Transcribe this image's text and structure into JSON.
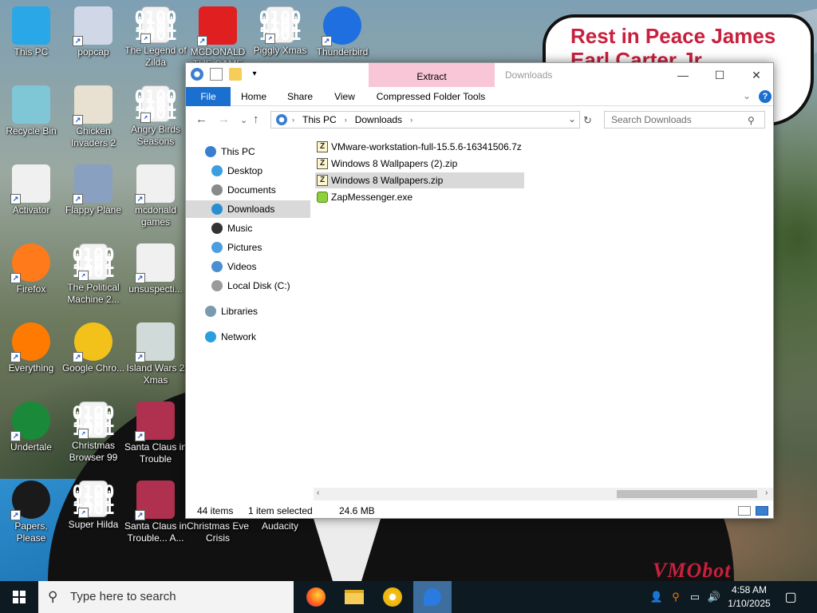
{
  "wallpaper": {
    "sign_text": "Rest in Peace James Earl Carter Jr.",
    "watermark": "VMObot"
  },
  "desktop_icons": [
    {
      "label": "This PC",
      "icon": "computer-icon",
      "color": "#2aa7e6"
    },
    {
      "label": "popcap",
      "icon": "popcap-icon",
      "color": "#d0d8e8"
    },
    {
      "label": "The Legend of Zilda",
      "icon": "binary-file-icon",
      "color": "#f3f3f3"
    },
    {
      "label": "MCDONALD THE GAME",
      "icon": "mcdonalds-icon",
      "color": "#e02020"
    },
    {
      "label": "Piggly Xmas",
      "icon": "binary-file-icon",
      "color": "#f3f3f3"
    },
    {
      "label": "Thunderbird",
      "icon": "thunderbird-icon",
      "color": "#1f6fe0"
    },
    {
      "label": "Recycle Bin",
      "icon": "recycle-bin-icon",
      "color": "#7fc7d7"
    },
    {
      "label": "Chicken Invaders 2",
      "icon": "chicken-invaders-icon",
      "color": "#e8e0d0"
    },
    {
      "label": "Angry Birds Seasons",
      "icon": "binary-file-icon",
      "color": "#f3f3f3"
    },
    {
      "label": "Activator",
      "icon": "blank-file-icon",
      "color": "#f0f0f0"
    },
    {
      "label": "Flappy Plane",
      "icon": "flappy-plane-icon",
      "color": "#8aa0c0"
    },
    {
      "label": "mcdonald games",
      "icon": "blank-file-icon",
      "color": "#f0f0f0"
    },
    {
      "label": "Firefox",
      "icon": "firefox-icon",
      "color": "#ff7a1a"
    },
    {
      "label": "The Political Machine 2...",
      "icon": "binary-file-icon",
      "color": "#f3f3f3"
    },
    {
      "label": "unsuspecti...",
      "icon": "blank-file-icon",
      "color": "#f0f0f0"
    },
    {
      "label": "Everything",
      "icon": "everything-search-icon",
      "color": "#ff7a00"
    },
    {
      "label": "Google Chro...",
      "icon": "chrome-icon",
      "color": "#f2c21a"
    },
    {
      "label": "Island Wars 2 Xmas",
      "icon": "island-wars-icon",
      "color": "#d0dad8"
    },
    {
      "label": "Undertale",
      "icon": "undertale-icon",
      "color": "#1a8a3a"
    },
    {
      "label": "Christmas Browser 99",
      "icon": "binary-file-icon",
      "color": "#f3f3f3"
    },
    {
      "label": "Santa Claus in Trouble",
      "icon": "santa-claus-icon",
      "color": "#b03050"
    },
    {
      "label": "Papers, Please",
      "icon": "papers-please-icon",
      "color": "#1a1a1a"
    },
    {
      "label": "Super Hilda",
      "icon": "binary-file-icon",
      "color": "#f3f3f3"
    },
    {
      "label": "Santa Claus in Trouble... A...",
      "icon": "santa-claus-icon",
      "color": "#b03050"
    },
    {
      "label": "Christmas Eve Crisis",
      "icon": "",
      "color": ""
    },
    {
      "label": "Audacity",
      "icon": "",
      "color": ""
    }
  ],
  "explorer": {
    "title": "Downloads",
    "contextual_tab": "Extract",
    "ribbon_tabs": [
      "File",
      "Home",
      "Share",
      "View",
      "Compressed Folder Tools"
    ],
    "address": {
      "root": "This PC",
      "folder": "Downloads"
    },
    "search_placeholder": "Search Downloads",
    "nav_items": [
      {
        "label": "This PC",
        "icon": "this-pc-icon",
        "level": 0
      },
      {
        "label": "Desktop",
        "icon": "desktop-icon",
        "level": 1
      },
      {
        "label": "Documents",
        "icon": "documents-icon",
        "level": 1
      },
      {
        "label": "Downloads",
        "icon": "downloads-icon",
        "level": 1,
        "selected": true
      },
      {
        "label": "Music",
        "icon": "music-icon",
        "level": 1
      },
      {
        "label": "Pictures",
        "icon": "pictures-icon",
        "level": 1
      },
      {
        "label": "Videos",
        "icon": "videos-icon",
        "level": 1
      },
      {
        "label": "Local Disk (C:)",
        "icon": "local-disk-icon",
        "level": 1
      },
      {
        "label": "Libraries",
        "icon": "libraries-icon",
        "level": 0
      },
      {
        "label": "Network",
        "icon": "network-icon",
        "level": 0
      }
    ],
    "files": [
      {
        "name": "VMware-workstation-full-15.5.6-16341506.7z",
        "icon": "archive-icon",
        "selected": false
      },
      {
        "name": "Windows 8 Wallpapers (2).zip",
        "icon": "zip-icon",
        "selected": false
      },
      {
        "name": "Windows 8 Wallpapers.zip",
        "icon": "zip-icon",
        "selected": true
      },
      {
        "name": "ZapMessenger.exe",
        "icon": "exe-icon",
        "selected": false
      }
    ],
    "status": {
      "items": "44 items",
      "selected": "1 item selected",
      "size": "24.6 MB"
    }
  },
  "taskbar": {
    "search_placeholder": "Type here to search",
    "apps": [
      "firefox-icon",
      "file-explorer-icon",
      "chrome-icon",
      "thunderbird-icon"
    ],
    "time": "4:58 AM",
    "date": "1/10/2025"
  }
}
